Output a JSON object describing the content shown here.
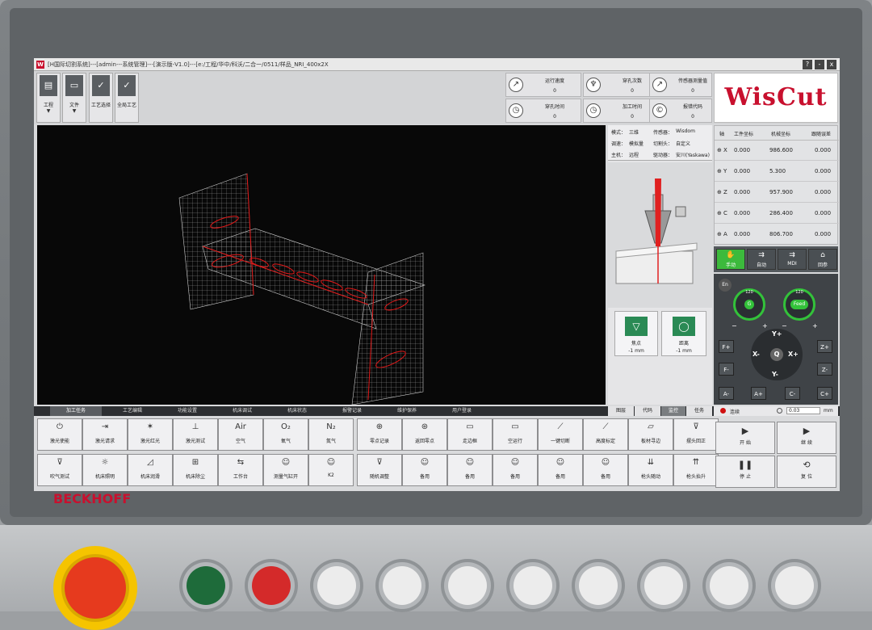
{
  "window": {
    "title": "[H国际切割系统]---[admin---系统管理]---[演示版-V1.0]---[e:/工程/华中/科沃/二合一/0511/样品_NRI_400x2X",
    "btn_help": "?",
    "btn_min": "-",
    "btn_close": "x"
  },
  "toolbar": {
    "project": {
      "label": "工程",
      "arrow": "▼"
    },
    "file": {
      "label": "文件",
      "arrow": "▼"
    },
    "process_select": {
      "label": "工艺选择"
    },
    "global_process": {
      "label": "全局工艺"
    }
  },
  "stats": {
    "run_speed": {
      "label": "运行速度",
      "value": "0"
    },
    "pierce_count": {
      "label": "穿孔次数",
      "value": "0"
    },
    "follow_value": {
      "label": "传感器测量值",
      "value": "0"
    },
    "pierce_time": {
      "label": "穿孔时间",
      "value": "0"
    },
    "process_time": {
      "label": "加工时间",
      "value": "0"
    },
    "error_code": {
      "label": "报错代码",
      "value": "0"
    }
  },
  "brand": {
    "logo_text": "WisCut"
  },
  "machine_info": {
    "mode_label": "模式：",
    "mode_value": "三维",
    "sensor_label": "传感器：",
    "sensor_value": "Wisdom",
    "speed_label": "调速：",
    "speed_value": "模拟量",
    "cut_head_label": "切割头：",
    "cut_head_value": "自定义",
    "host_label": "主机：",
    "host_value": "远程",
    "drive_label": "驱动器：",
    "drive_value": "安川(Yaskawa)"
  },
  "focus": {
    "label": "焦点",
    "value": "-1 mm"
  },
  "distance": {
    "label": "距离",
    "value": "-1 mm"
  },
  "coords": {
    "headers": [
      "轴",
      "工件坐标",
      "机械坐标",
      "跟随误差"
    ],
    "rows": [
      {
        "axis": "X",
        "work": "0.000",
        "machine": "986.600",
        "error": "0.000"
      },
      {
        "axis": "Y",
        "work": "0.000",
        "machine": "5.300",
        "error": "0.000"
      },
      {
        "axis": "Z",
        "work": "0.000",
        "machine": "957.900",
        "error": "0.000"
      },
      {
        "axis": "C",
        "work": "0.000",
        "machine": "286.400",
        "error": "0.000"
      },
      {
        "axis": "A",
        "work": "0.000",
        "machine": "806.700",
        "error": "0.000"
      }
    ]
  },
  "modes": {
    "manual": "手动",
    "auto": "自动",
    "mdi": "MDI",
    "home": "回参"
  },
  "jog": {
    "en": "En",
    "g_dial": "G",
    "feed_dial": "Feed",
    "dial_top": "120",
    "dial_left": "−",
    "dial_right": "+",
    "axes": {
      "yplus": "Y+",
      "yminus": "Y-",
      "xminus": "X-",
      "xplus": "X+",
      "center": "Q"
    },
    "left_keys": [
      "F+",
      "F-",
      "A-"
    ],
    "right_keys": [
      "Z+",
      "Z-",
      "C+"
    ],
    "bottom_keys": [
      "A+",
      "C-"
    ]
  },
  "bottom_tabs": [
    "加工任务",
    "工艺编辑",
    "功能设置",
    "机床调试",
    "机床状态",
    "报警记录",
    "维护保养",
    "用户登录"
  ],
  "right_tabs": [
    "图层",
    "代码",
    "监控",
    "任务"
  ],
  "continuous": {
    "label": "连续",
    "step_value": "0.03",
    "unit": "mm"
  },
  "fkeys": {
    "row1": [
      {
        "icon": "⏻",
        "label": "激光使能"
      },
      {
        "icon": "⇥",
        "label": "激光请求"
      },
      {
        "icon": "✶",
        "label": "激光红光"
      },
      {
        "icon": "⊥",
        "label": "激光测试"
      },
      {
        "icon": "Air",
        "label": "空气"
      },
      {
        "icon": "O₂",
        "label": "氧气"
      },
      {
        "icon": "N₂",
        "label": "氮气"
      },
      {
        "icon": "⊕",
        "label": "零点记录"
      },
      {
        "icon": "⊛",
        "label": "返回零点"
      },
      {
        "icon": "▭",
        "label": "走边框"
      },
      {
        "icon": "▭",
        "label": "空运行"
      },
      {
        "icon": "⟋",
        "label": "一键切断"
      },
      {
        "icon": "⟋",
        "label": "高度标定"
      },
      {
        "icon": "▱",
        "label": "板材寻边"
      },
      {
        "icon": "⊽",
        "label": "摆头回正"
      }
    ],
    "row2": [
      {
        "icon": "⊽",
        "label": "吹气测试"
      },
      {
        "icon": "☼",
        "label": "机床照明"
      },
      {
        "icon": "◿",
        "label": "机床润滑"
      },
      {
        "icon": "⊞",
        "label": "机床除尘"
      },
      {
        "icon": "⇆",
        "label": "工作台"
      },
      {
        "icon": "☺",
        "label": "测量气缸开"
      },
      {
        "icon": "☺",
        "label": "K2"
      },
      {
        "icon": "⊽",
        "label": "随机调整"
      },
      {
        "icon": "☺",
        "label": "备用"
      },
      {
        "icon": "☺",
        "label": "备用"
      },
      {
        "icon": "☺",
        "label": "备用"
      },
      {
        "icon": "☺",
        "label": "备用"
      },
      {
        "icon": "☺",
        "label": "备用"
      },
      {
        "icon": "⇊",
        "label": "枪头随动"
      },
      {
        "icon": "⇈",
        "label": "枪头抬升"
      }
    ]
  },
  "run_buttons": {
    "start": {
      "icon": "▶",
      "label": "开 始"
    },
    "continue": {
      "icon": "▶",
      "label": "继 续"
    },
    "pause": {
      "icon": "❚❚",
      "label": "停 止"
    },
    "reset": {
      "icon": "⟲",
      "label": "复 位"
    }
  },
  "hardware": {
    "brand": "BECKHOFF"
  }
}
